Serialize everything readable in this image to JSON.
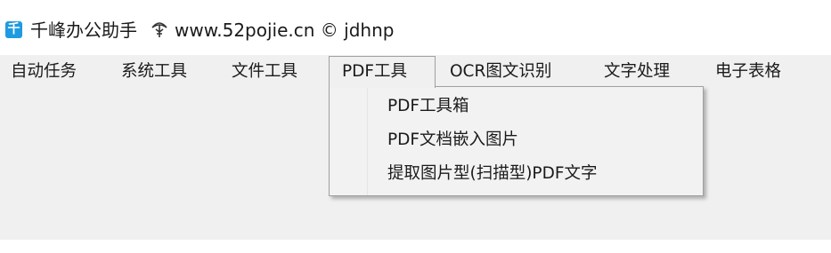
{
  "window": {
    "app_icon_glyph": "千",
    "title_prefix": "千峰办公助手",
    "logo_icon": "52pojie-logo-icon",
    "title_suffix": "www.52pojie.cn © jdhnp"
  },
  "menu": {
    "items": [
      {
        "label": "自动任务"
      },
      {
        "label": "系统工具"
      },
      {
        "label": "文件工具"
      },
      {
        "label": "PDF工具",
        "active": true
      },
      {
        "label": "OCR图文识别"
      },
      {
        "label": "文字处理"
      },
      {
        "label": "电子表格"
      }
    ]
  },
  "dropdown": {
    "items": [
      {
        "label": "PDF工具箱"
      },
      {
        "label": "PDF文档嵌入图片"
      },
      {
        "label": "提取图片型(扫描型)PDF文字"
      }
    ]
  },
  "colors": {
    "accent": "#1e9be0",
    "menu_background": "#f0f0f0",
    "border": "#a0a0a0"
  }
}
